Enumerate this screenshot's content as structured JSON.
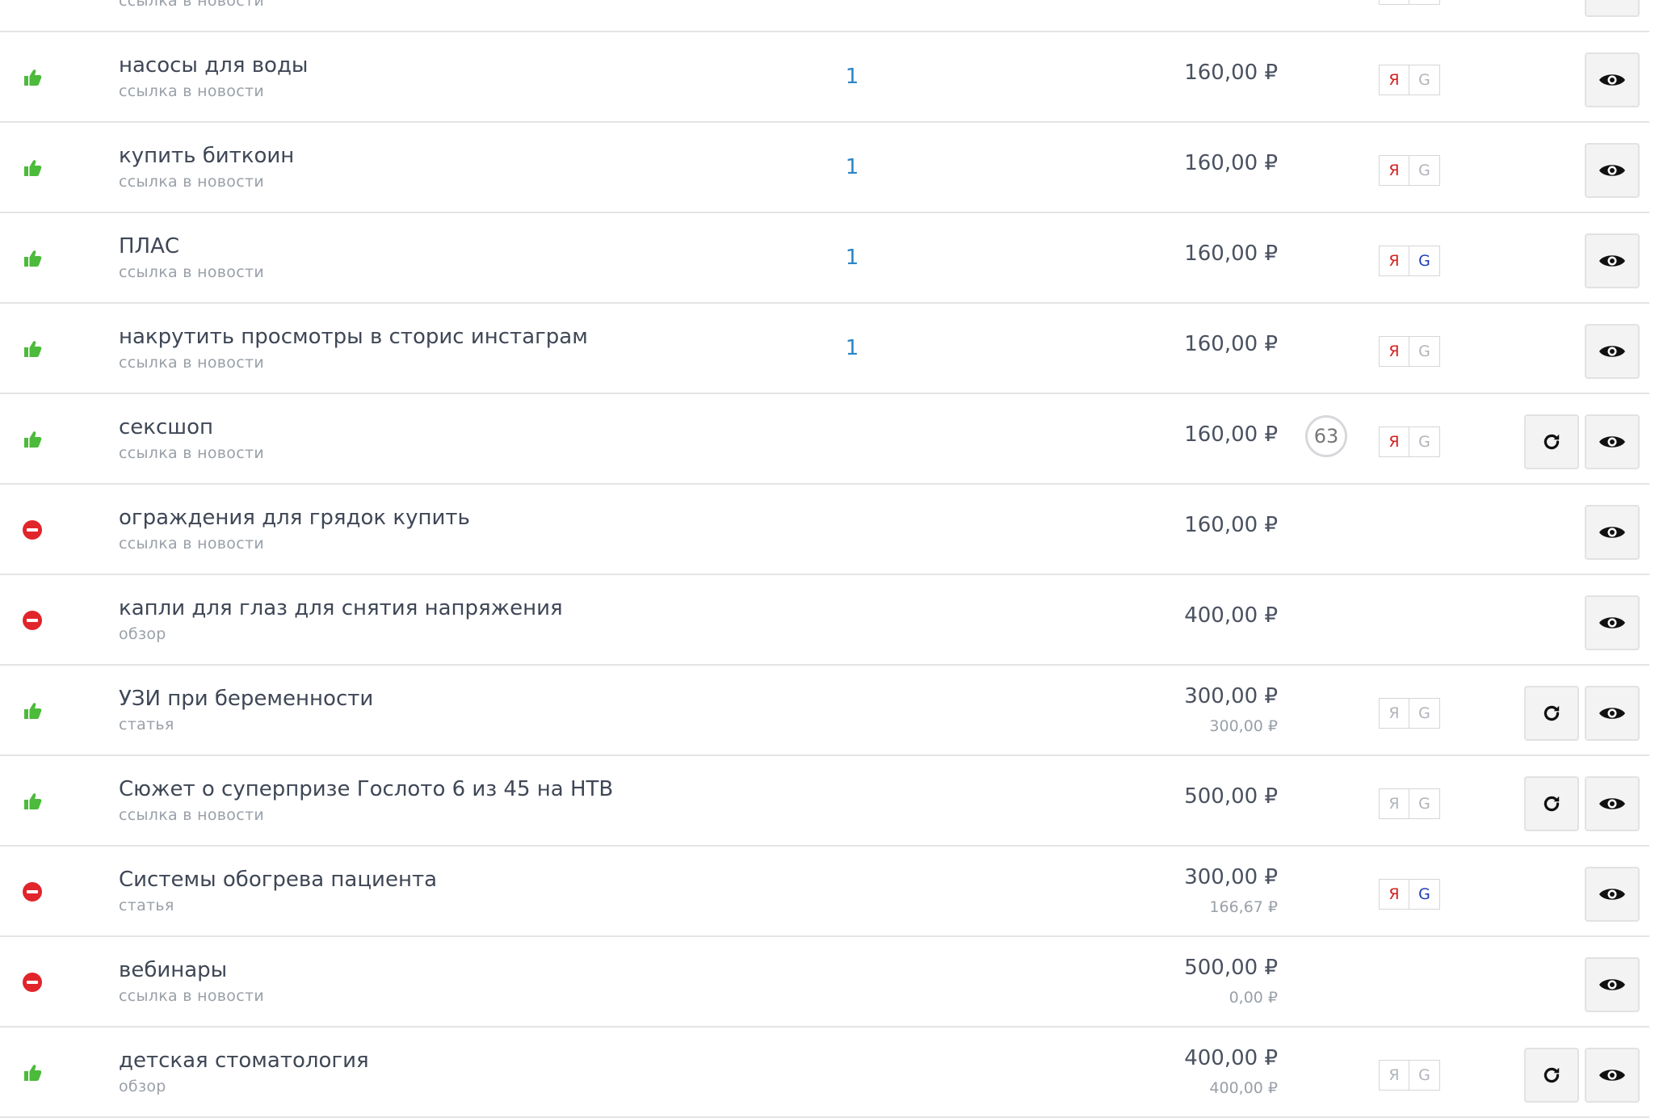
{
  "colors": {
    "accent": "#2b86c5",
    "status_active": "#4cba3b",
    "status_stopped": "#e0252b",
    "yandex_active": "#d42020",
    "google_active": "#1f3fb8"
  },
  "rows": [
    {
      "status": "active",
      "title": "",
      "subtitle": "ссылка в новости",
      "count": "",
      "price": "",
      "price2": "",
      "circle": "",
      "yandex": false,
      "google": false,
      "show_se": true,
      "refresh": false
    },
    {
      "status": "active",
      "title": "насосы для воды",
      "subtitle": "ссылка в новости",
      "count": "1",
      "price": "160,00 ₽",
      "price2": "",
      "circle": "",
      "yandex": true,
      "google": false,
      "show_se": true,
      "refresh": false
    },
    {
      "status": "active",
      "title": "купить биткоин",
      "subtitle": "ссылка в новости",
      "count": "1",
      "price": "160,00 ₽",
      "price2": "",
      "circle": "",
      "yandex": true,
      "google": false,
      "show_se": true,
      "refresh": false
    },
    {
      "status": "active",
      "title": "ПЛАС",
      "subtitle": "ссылка в новости",
      "count": "1",
      "price": "160,00 ₽",
      "price2": "",
      "circle": "",
      "yandex": true,
      "google": true,
      "show_se": true,
      "refresh": false
    },
    {
      "status": "active",
      "title": "накрутить просмотры в сторис инстаграм",
      "subtitle": "ссылка в новости",
      "count": "1",
      "price": "160,00 ₽",
      "price2": "",
      "circle": "",
      "yandex": true,
      "google": false,
      "show_se": true,
      "refresh": false
    },
    {
      "status": "active",
      "title": "сексшоп",
      "subtitle": "ссылка в новости",
      "count": "",
      "price": "160,00 ₽",
      "price2": "",
      "circle": "63",
      "yandex": true,
      "google": false,
      "show_se": true,
      "refresh": true
    },
    {
      "status": "stopped",
      "title": "ограждения для грядок купить",
      "subtitle": "ссылка в новости",
      "count": "",
      "price": "160,00 ₽",
      "price2": "",
      "circle": "",
      "yandex": false,
      "google": false,
      "show_se": false,
      "refresh": false
    },
    {
      "status": "stopped",
      "title": "капли для глаз для снятия напряжения",
      "subtitle": "обзор",
      "count": "",
      "price": "400,00 ₽",
      "price2": "",
      "circle": "",
      "yandex": false,
      "google": false,
      "show_se": false,
      "refresh": false
    },
    {
      "status": "active",
      "title": "УЗИ при беременности",
      "subtitle": "статья",
      "count": "",
      "price": "300,00 ₽",
      "price2": "300,00 ₽",
      "circle": "",
      "yandex": false,
      "google": false,
      "show_se": true,
      "refresh": true
    },
    {
      "status": "active",
      "title": "Сюжет о суперпризе Гослото 6 из 45 на НТВ",
      "subtitle": "ссылка в новости",
      "count": "",
      "price": "500,00 ₽",
      "price2": "",
      "circle": "",
      "yandex": false,
      "google": false,
      "show_se": true,
      "refresh": true
    },
    {
      "status": "stopped",
      "title": "Системы обогрева пациента",
      "subtitle": "статья",
      "count": "",
      "price": "300,00 ₽",
      "price2": "166,67 ₽",
      "circle": "",
      "yandex": true,
      "google": true,
      "show_se": true,
      "refresh": false
    },
    {
      "status": "stopped",
      "title": "вебинары",
      "subtitle": "ссылка в новости",
      "count": "",
      "price": "500,00 ₽",
      "price2": "0,00 ₽",
      "circle": "",
      "yandex": false,
      "google": false,
      "show_se": false,
      "refresh": false
    },
    {
      "status": "active",
      "title": "детская стоматология",
      "subtitle": "обзор",
      "count": "",
      "price": "400,00 ₽",
      "price2": "400,00 ₽",
      "circle": "",
      "yandex": false,
      "google": false,
      "show_se": true,
      "refresh": true
    }
  ],
  "labels": {
    "yandex": "Я",
    "google": "G"
  },
  "icons": {
    "active": "thumbs-up-icon",
    "stopped": "no-entry-icon",
    "refresh": "refresh-icon",
    "view": "eye-icon"
  }
}
